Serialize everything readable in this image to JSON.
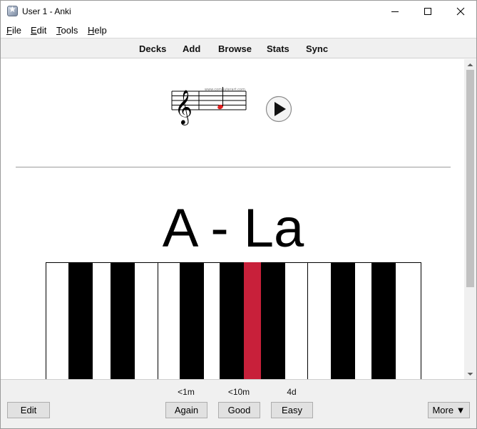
{
  "window": {
    "title": "User 1 - Anki"
  },
  "menu": {
    "items": [
      {
        "accel": "F",
        "rest": "ile"
      },
      {
        "accel": "E",
        "rest": "dit"
      },
      {
        "accel": "T",
        "rest": "ools"
      },
      {
        "accel": "H",
        "rest": "elp"
      }
    ]
  },
  "toolbar": {
    "links": [
      "Decks",
      "Add",
      "Browse",
      "Stats",
      "Sync"
    ]
  },
  "card": {
    "staff_watermark": "www.computerart.com",
    "answer_text": "A - La",
    "piano": {
      "highlighted_key": "A",
      "highlight_color": "#c8203a"
    }
  },
  "answer_bar": {
    "intervals": [
      "<1m",
      "<10m",
      "4d"
    ],
    "edit_label": "Edit",
    "again_label": "Again",
    "good_label": "Good",
    "easy_label": "Easy",
    "more_label": "More ▼"
  }
}
